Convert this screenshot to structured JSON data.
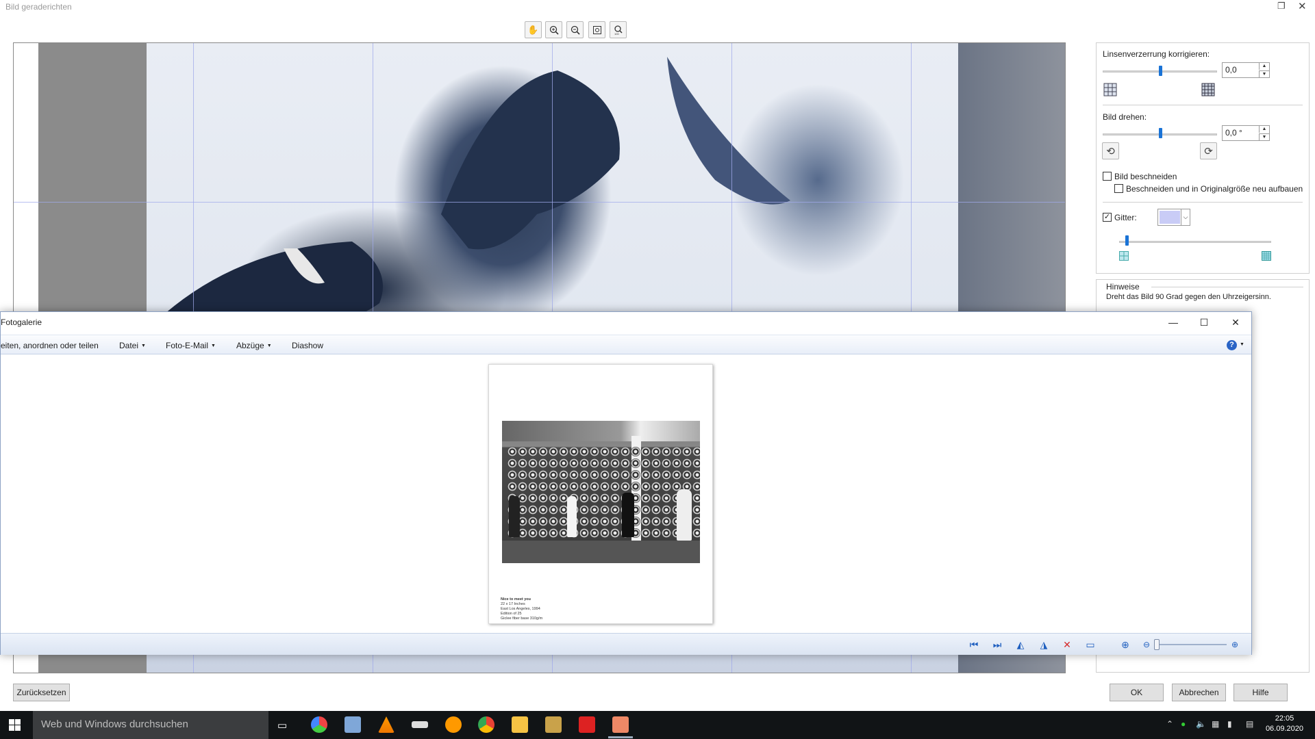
{
  "straighten_dialog": {
    "title": "Bild geraderichten",
    "lens_label": "Linsenverzerrung korrigieren:",
    "lens_value": "0,0",
    "lens_slider_fraction": 0.5,
    "rotate_label": "Bild drehen:",
    "rotate_value": "0,0 °",
    "rotate_slider_fraction": 0.5,
    "crop_label": "Bild beschneiden",
    "crop_checked": false,
    "crop_rebuild_label": "Beschneiden und in Originalgröße neu aufbauen",
    "crop_rebuild_checked": false,
    "grid_label": "Gitter:",
    "grid_checked": true,
    "grid_color": "#c9ccf6",
    "grid_slider_fraction": 0.05,
    "hints_title": "Hinweise",
    "hints_text": "Dreht das Bild 90 Grad gegen den Uhrzeigersinn.",
    "reset_label": "Zurücksetzen",
    "ok_label": "OK",
    "cancel_label": "Abbrechen",
    "help_label": "Hilfe"
  },
  "gallery": {
    "title": "Fotogalerie",
    "menu": {
      "organize": "eiten, anordnen oder teilen",
      "file": "Datei",
      "email": "Foto-E-Mail",
      "prints": "Abzüge",
      "slideshow": "Diashow"
    },
    "caption": {
      "line1": "Nice to meet you",
      "line2": "22 x 17 Inches",
      "line3": "East Los Angeles, 1994",
      "line4": "Edition of 25",
      "line5": "Giclee fiber base 310g/m"
    },
    "zoom_fraction": 0.0
  },
  "taskbar": {
    "search_placeholder": "Web und Windows durchsuchen",
    "time": "22:05",
    "date": "06.09.2020"
  }
}
